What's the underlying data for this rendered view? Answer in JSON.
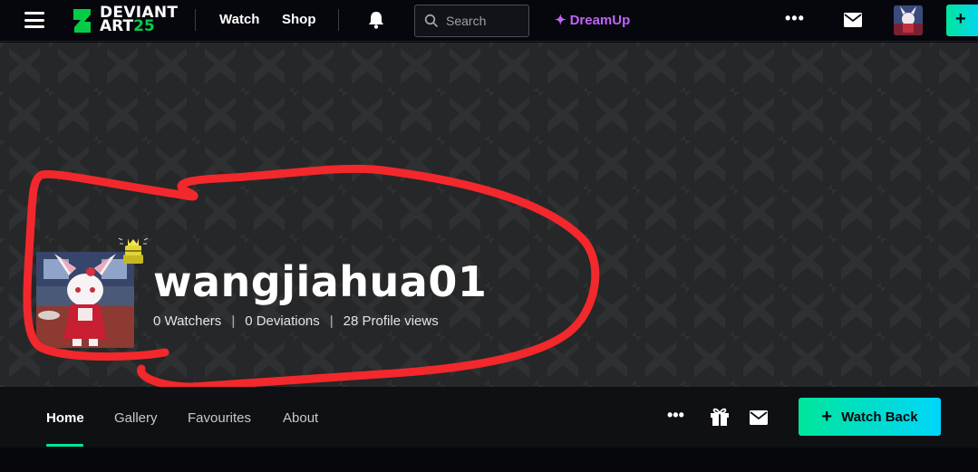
{
  "header": {
    "logo": {
      "line1": "DEVIANT",
      "line2": "ART",
      "badge": "25",
      "icon": "deviantart-logo-icon"
    },
    "nav": [
      {
        "label": "Watch"
      },
      {
        "label": "Shop"
      }
    ],
    "search_placeholder": "Search",
    "dreamup_label": "DreamUp",
    "more_label": "•••",
    "create_label": "+"
  },
  "profile": {
    "username": "wangjiahua01",
    "stats": {
      "watchers": "0 Watchers",
      "deviations": "0 Deviations",
      "views": "28 Profile views"
    }
  },
  "tabs": [
    {
      "label": "Home",
      "active": true
    },
    {
      "label": "Gallery"
    },
    {
      "label": "Favourites"
    },
    {
      "label": "About"
    }
  ],
  "actions": {
    "more_label": "•••",
    "watch_back_label": "Watch Back",
    "watch_back_plus": "+"
  },
  "colors": {
    "accent": "#00e59b",
    "accent2": "#00d6fa",
    "dreamup": "#c064f8",
    "scribble": "#f2282c",
    "background": "#06070d",
    "banner": "#262728"
  }
}
